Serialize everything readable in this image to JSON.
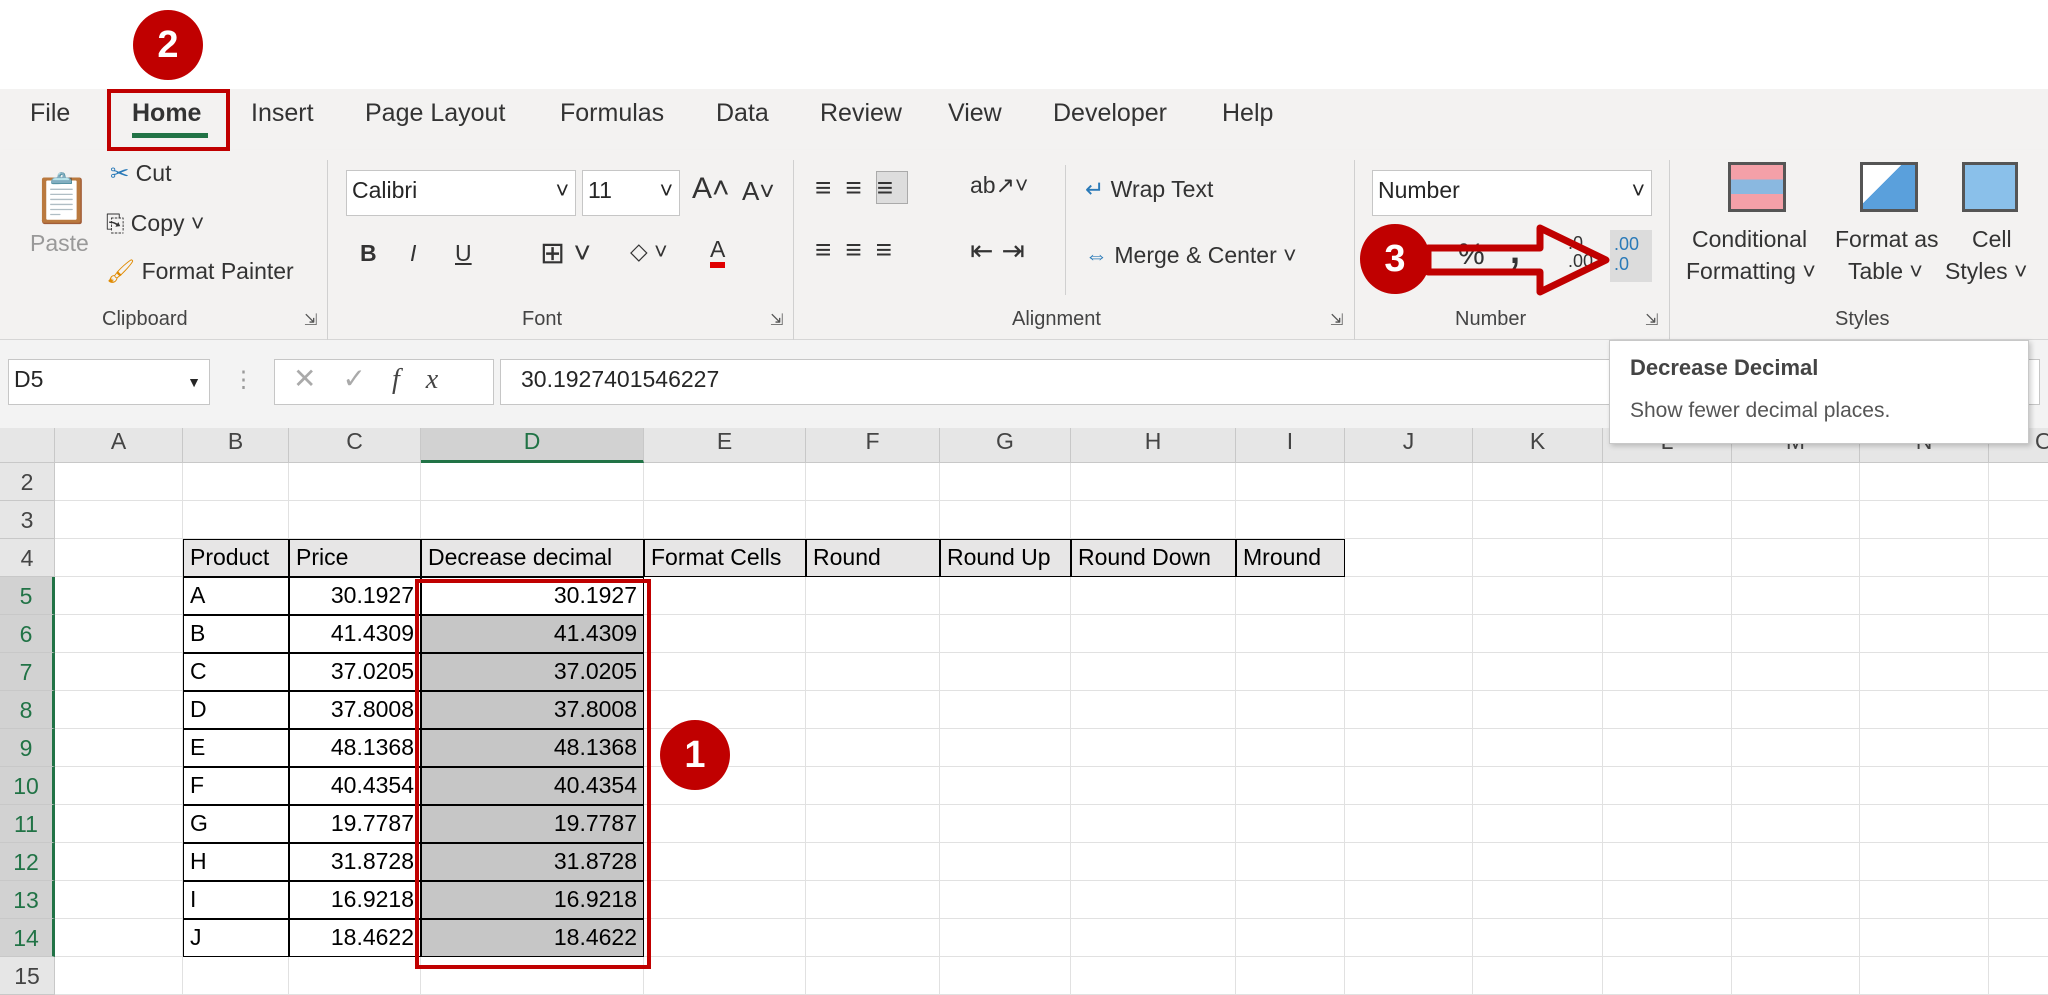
{
  "tabs": [
    "File",
    "Home",
    "Insert",
    "Page Layout",
    "Formulas",
    "Data",
    "Review",
    "View",
    "Developer",
    "Help"
  ],
  "active_tab": "Home",
  "clipboard": {
    "paste": "Paste",
    "cut": "Cut",
    "copy": "Copy",
    "format_painter": "Format Painter",
    "label": "Clipboard"
  },
  "font": {
    "name": "Calibri",
    "size": "11",
    "bold": "B",
    "italic": "I",
    "underline": "U",
    "label": "Font"
  },
  "alignment": {
    "wrap_text": "Wrap Text",
    "merge_center": "Merge & Center",
    "label": "Alignment"
  },
  "number": {
    "format": "Number",
    "percent": "%",
    "comma": ",",
    "increase": ".0 .00",
    "decrease": ".00 .0",
    "label": "Number"
  },
  "styles": {
    "conditional": [
      "Conditional",
      "Formatting"
    ],
    "format_table": [
      "Format as",
      "Table"
    ],
    "cell_styles": [
      "Cell",
      "Styles"
    ],
    "label": "Styles"
  },
  "formula_bar": {
    "name_box": "D5",
    "fx": "fx",
    "value": "30.1927401546227"
  },
  "tooltip": {
    "title": "Decrease Decimal",
    "text": "Show fewer decimal places."
  },
  "columns": [
    "A",
    "B",
    "C",
    "D",
    "E",
    "F",
    "G",
    "H",
    "I",
    "J",
    "K",
    "L",
    "M",
    "N",
    "O"
  ],
  "rows": [
    "2",
    "3",
    "4",
    "5",
    "6",
    "7",
    "8",
    "9",
    "10",
    "11",
    "12",
    "13",
    "14",
    "15"
  ],
  "headers": [
    "Product",
    "Price",
    "Decrease decimal",
    "Format Cells",
    "Round",
    "Round Up",
    "Round Down",
    "Mround"
  ],
  "table": [
    [
      "A",
      "30.1927",
      "30.1927"
    ],
    [
      "B",
      "41.4309",
      "41.4309"
    ],
    [
      "C",
      "37.0205",
      "37.0205"
    ],
    [
      "D",
      "37.8008",
      "37.8008"
    ],
    [
      "E",
      "48.1368",
      "48.1368"
    ],
    [
      "F",
      "40.4354",
      "40.4354"
    ],
    [
      "G",
      "19.7787",
      "19.7787"
    ],
    [
      "H",
      "31.8728",
      "31.8728"
    ],
    [
      "I",
      "16.9218",
      "16.9218"
    ],
    [
      "J",
      "18.4622",
      "18.4622"
    ]
  ],
  "annotations": [
    "1",
    "2",
    "3"
  ],
  "colors": {
    "accent": "#217346",
    "annotation": "#c00000",
    "selection": "#c6c6c6"
  }
}
